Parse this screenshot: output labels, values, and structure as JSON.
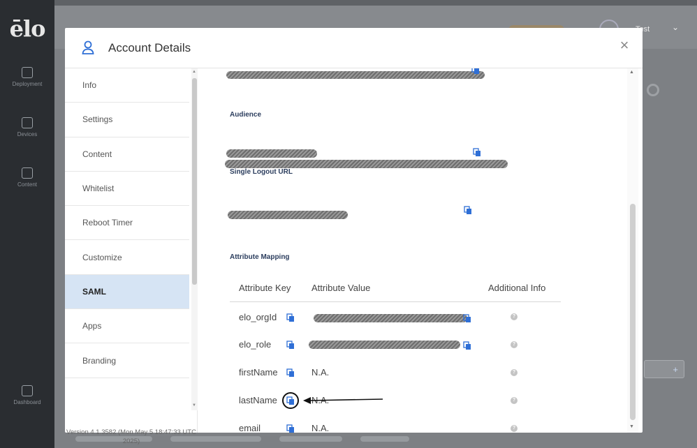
{
  "rail": {
    "logo": "ēlo",
    "items": [
      {
        "label": "Deployment",
        "icon": "deploy-icon"
      },
      {
        "label": "Devices",
        "icon": "devices-icon"
      },
      {
        "label": "Content",
        "icon": "grid-icon"
      },
      {
        "label": "Dashboard",
        "icon": "dashboard-icon"
      }
    ]
  },
  "background": {
    "user_name": "Test"
  },
  "modal": {
    "title": "Account Details",
    "close_label": "×"
  },
  "menu": {
    "items": [
      {
        "label": "Info"
      },
      {
        "label": "Settings"
      },
      {
        "label": "Content"
      },
      {
        "label": "Whitelist"
      },
      {
        "label": "Reboot Timer"
      },
      {
        "label": "Customize"
      },
      {
        "label": "SAML",
        "active": true
      },
      {
        "label": "Apps"
      },
      {
        "label": "Branding"
      }
    ],
    "version": "Version 4.1.3582 (Mon May 5 18:47:33 UTC 2025)"
  },
  "saml": {
    "audience_label": "Audience",
    "logout_label": "Single Logout URL",
    "attribute_mapping_label": "Attribute Mapping",
    "columns": [
      "Attribute Key",
      "Attribute Value",
      "Additional Info"
    ],
    "rows": [
      {
        "key": "elo_orgId",
        "value": ""
      },
      {
        "key": "elo_role",
        "value": ""
      },
      {
        "key": "firstName",
        "value": "N.A."
      },
      {
        "key": "lastName",
        "value": "N.A."
      },
      {
        "key": "email",
        "value": "N.A."
      }
    ]
  },
  "colors": {
    "accent": "#2f6fd6",
    "active_menu_bg": "#d6e4f4",
    "label_navy": "#2c3e5e"
  }
}
